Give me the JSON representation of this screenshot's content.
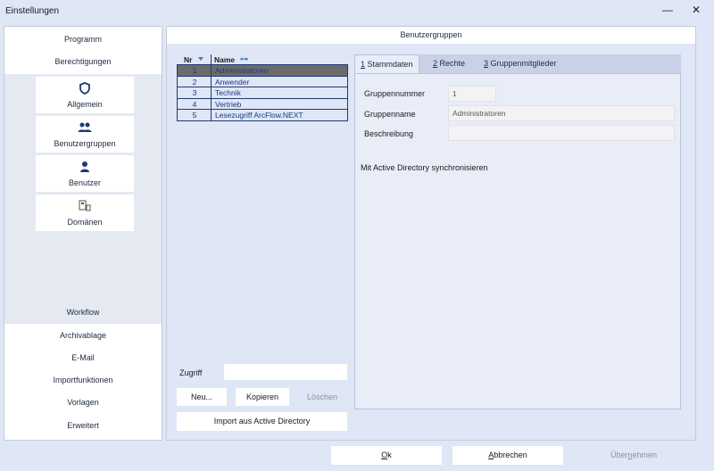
{
  "window": {
    "title": "Einstellungen",
    "minimize_glyph": "—",
    "close_glyph": "✕"
  },
  "left_nav": {
    "top_items": [
      "Programm",
      "Berechtigungen"
    ],
    "sub_items": [
      {
        "label": "Allgemein",
        "icon": "shield-icon"
      },
      {
        "label": "Benutzergruppen",
        "icon": "users-icon"
      },
      {
        "label": "Benutzer",
        "icon": "user-icon"
      },
      {
        "label": "Domänen",
        "icon": "domain-icon"
      }
    ],
    "bottom_items": [
      "Workflow",
      "Archivablage",
      "E-Mail",
      "Importfunktionen",
      "Vorlagen",
      "Erweitert"
    ]
  },
  "main": {
    "header": "Benutzergruppen",
    "grid": {
      "columns": [
        "Nr",
        "Name"
      ],
      "rows": [
        {
          "nr": "1",
          "name": "Administratoren",
          "selected": true
        },
        {
          "nr": "2",
          "name": "Anwender",
          "selected": false
        },
        {
          "nr": "3",
          "name": "Technik",
          "selected": false
        },
        {
          "nr": "4",
          "name": "Vertrieb",
          "selected": false
        },
        {
          "nr": "5",
          "name": "Lesezugriff ArcFlow.NEXT",
          "selected": false
        }
      ]
    },
    "zugriff_label": "Zugriff",
    "zugriff_value": "",
    "buttons": {
      "neu": "Neu...",
      "kopieren": "Kopieren",
      "loeschen": "Löschen",
      "import_ad": "Import aus Active Directory"
    },
    "tabs": [
      {
        "key": "1",
        "label": " Stammdaten",
        "active": true
      },
      {
        "key": "2",
        "label": " Rechte",
        "active": false
      },
      {
        "key": "3",
        "label": " Gruppenmitglieder",
        "active": false
      }
    ],
    "form": {
      "gruppennummer_label": "Gruppennummer",
      "gruppennummer_value": "1",
      "gruppenname_label": "Gruppenname",
      "gruppenname_value": "Administratoren",
      "beschreibung_label": "Beschreibung",
      "beschreibung_value": "",
      "ad_sync_label": "Mit Active Directory synchronisieren"
    }
  },
  "footer": {
    "ok_key": "O",
    "ok_rest": "k",
    "abbrechen_key": "A",
    "abbrechen_rest": "bbrechen",
    "uebernehmen_pre": "Über",
    "uebernehmen_key": "n",
    "uebernehmen_rest": "ehmen"
  },
  "colors": {
    "background": "#dfe6f5",
    "accent_blue": "#3a78d6",
    "selected_row": "#6b6b6b",
    "link_text": "#1d3b80"
  }
}
